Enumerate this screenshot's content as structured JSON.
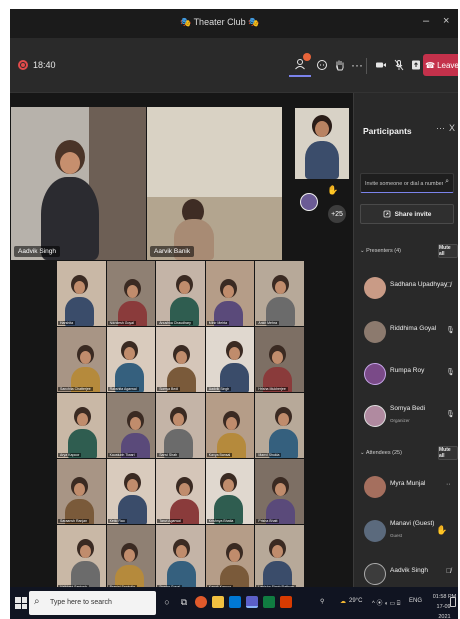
{
  "window": {
    "title": "Theater Club",
    "title_emoji": "🎭",
    "minimize": "–",
    "close": "×"
  },
  "meeting": {
    "timer": "18:40",
    "leave_label": "Leave",
    "participant_badge_color": "#e8643a"
  },
  "stage": {
    "featured": [
      {
        "name": "Aadvik Singh"
      },
      {
        "name": "Aarvik Banik"
      }
    ],
    "overflow_count": "+25"
  },
  "gallery": {
    "names": [
      "Harshita",
      "Nikhilesh Goyal",
      "Anushka Chaudhary",
      "Mihir Mehta",
      "Ankit Mehra",
      "Sanchita Chatterjee",
      "Rakshita Agarwal",
      "Somya Bedi",
      "Aadvik Singh",
      "Hrisha Mukherjee",
      "Arya Kapoor",
      "Kaustubh Tiwari",
      "Sanvi Shah",
      "Kavya Bansal",
      "Manvi Shukla",
      "Saraansh Ranjan",
      "Ketki Rao",
      "Tanvi Agarwal",
      "Krishnya Bhatia",
      "Prisha Bhatt",
      "Vaibhavi Santosh",
      "Pranjal Sankolla",
      "Sweha Goyal",
      "Kanak Kapoor",
      "Lenisha Singh Rathore"
    ]
  },
  "participants": {
    "title": "Participants",
    "more": "···",
    "close": "X",
    "invite_placeholder": "Invite someone or dial a number",
    "share_invite": "Share invite",
    "presenters_label": "Presenters (4)",
    "attendees_label": "Attendees (25)",
    "mute_all": "Mute all",
    "presenters": [
      {
        "name": "Sadhana Upadhyay",
        "sub": ""
      },
      {
        "name": "Riddhima Goyal",
        "sub": ""
      },
      {
        "name": "Rumpa Roy",
        "sub": ""
      },
      {
        "name": "Somya Bedi",
        "sub": "Organizer"
      }
    ],
    "attendees": [
      {
        "name": "Myra Munjal",
        "sub": ""
      },
      {
        "name": "Manavi (Guest)",
        "sub": "Guest"
      },
      {
        "name": "Aadvik Singh",
        "sub": ""
      }
    ]
  },
  "taskbar": {
    "search_placeholder": "Type here to search",
    "temperature": "29°C",
    "language": "ENG",
    "time": "01:58 PM",
    "date": "17-09-2021"
  }
}
